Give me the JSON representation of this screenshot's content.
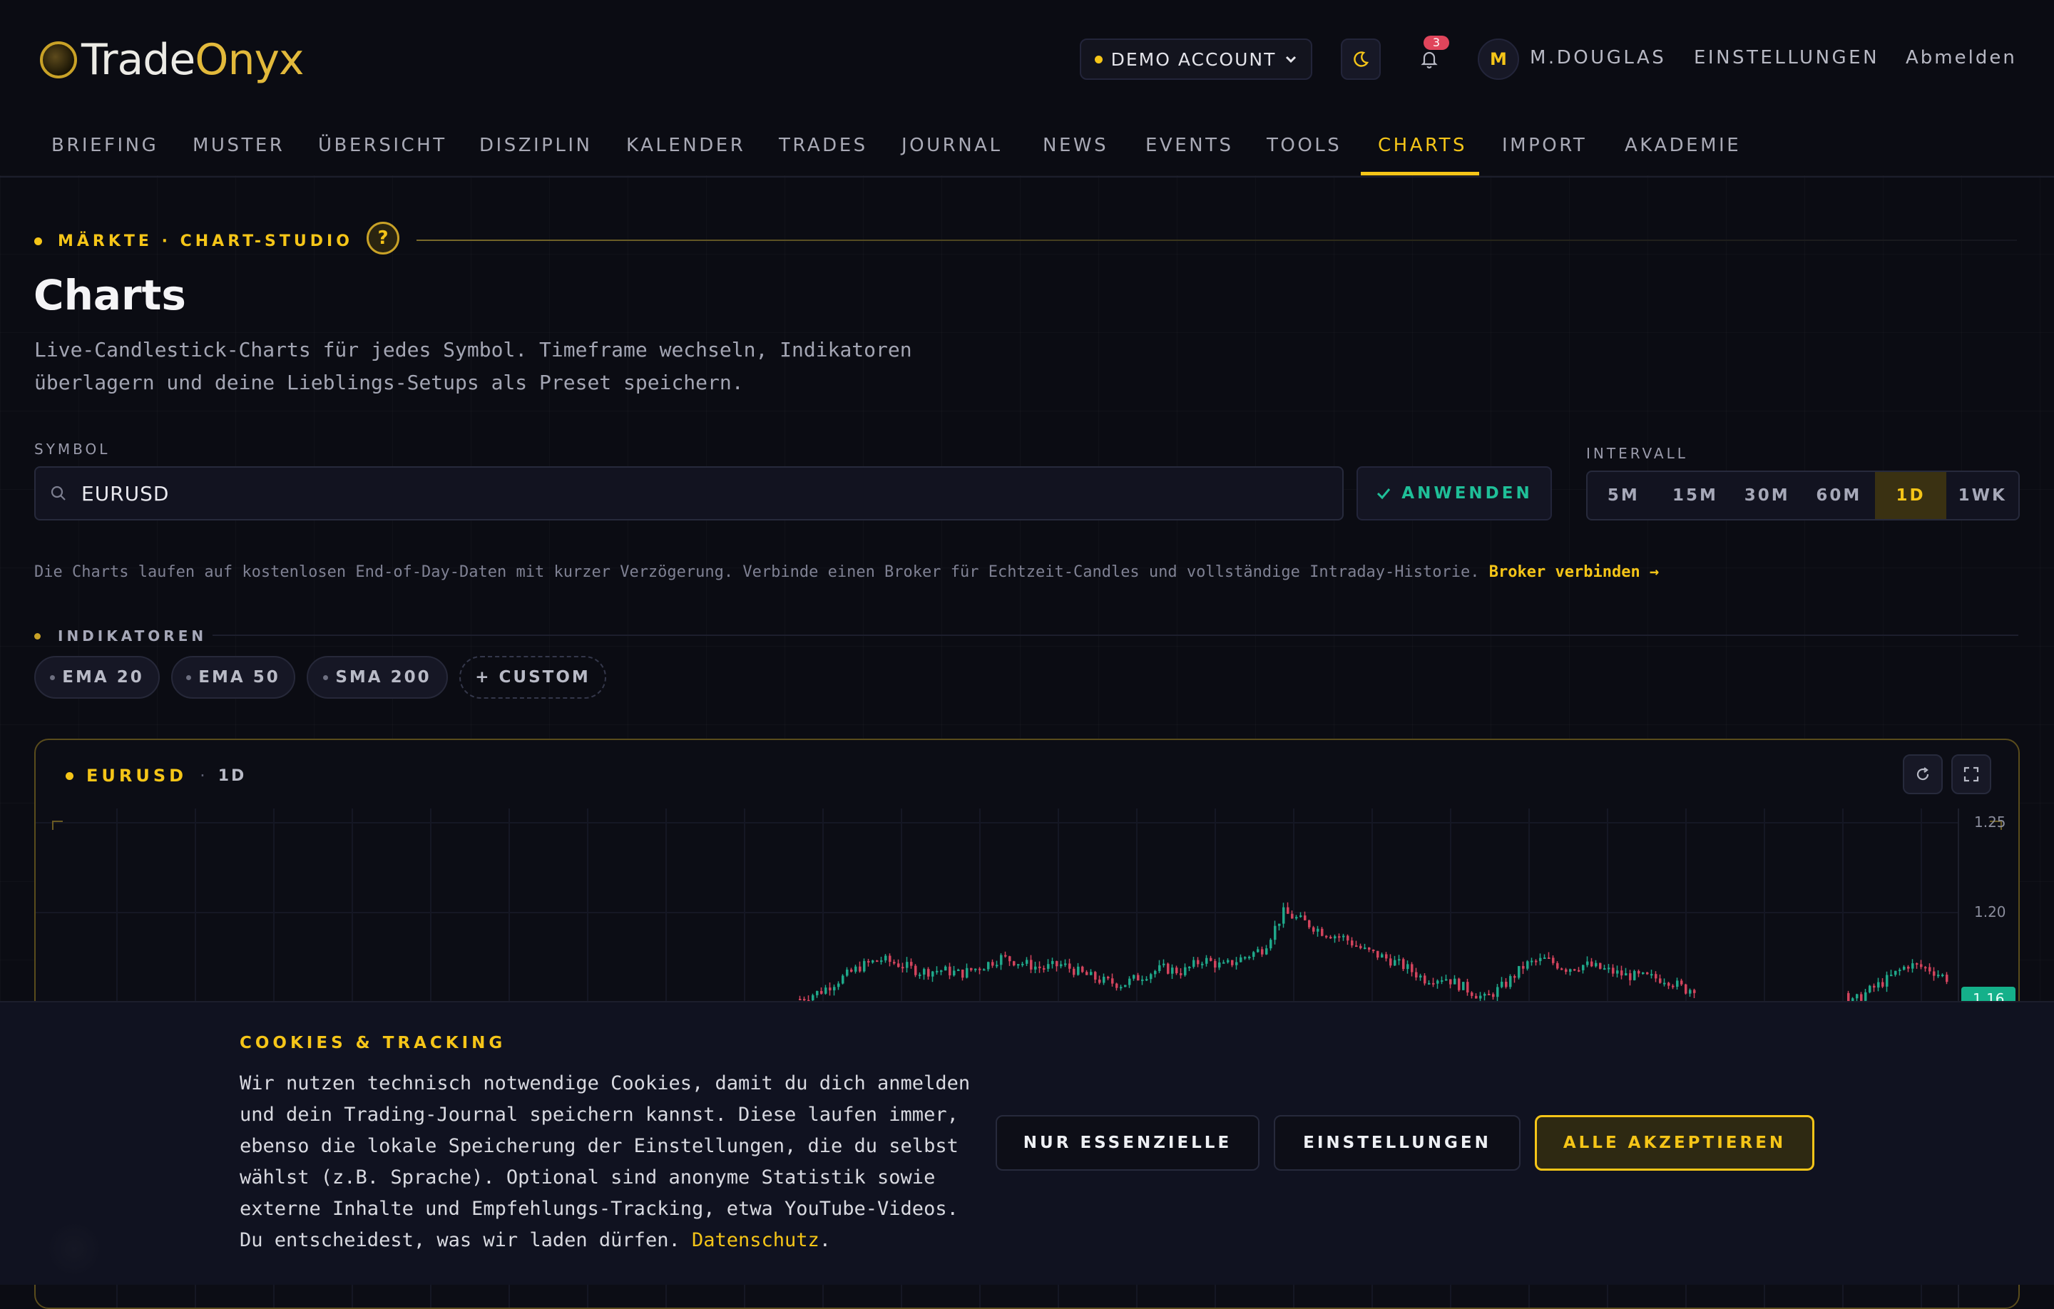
{
  "brand": {
    "name_part1": "Trade",
    "name_part2": "Onyx"
  },
  "header": {
    "account_label": "DEMO ACCOUNT",
    "notification_count": "3",
    "avatar_initial": "M",
    "username": "M.DOUGLAS",
    "settings_label": "EINSTELLUNGEN",
    "logout_label": "Abmelden"
  },
  "nav": {
    "items": [
      "BRIEFING",
      "MUSTER",
      "ÜBERSICHT",
      "DISZIPLIN",
      "KALENDER",
      "TRADES",
      "JOURNAL",
      "NEWS",
      "EVENTS",
      "TOOLS",
      "CHARTS",
      "IMPORT",
      "AKADEMIE"
    ],
    "active": "CHARTS"
  },
  "page": {
    "eyebrow": "MÄRKTE · CHART-STUDIO",
    "help_glyph": "?",
    "title": "Charts",
    "subtitle_line1": "Live-Candlestick-Charts für jedes Symbol. Timeframe wechseln, Indikatoren",
    "subtitle_line2": "überlagern und deine Lieblings-Setups als Preset speichern."
  },
  "symbol": {
    "label": "SYMBOL",
    "value": "EURUSD",
    "apply_label": "ANWENDEN"
  },
  "interval": {
    "label": "INTERVALL",
    "options": [
      "5M",
      "15M",
      "30M",
      "60M",
      "1D",
      "1WK"
    ],
    "selected": "1D"
  },
  "info": {
    "text": "Die Charts laufen auf kostenlosen End-of-Day-Daten mit kurzer Verzögerung. Verbinde einen Broker für Echtzeit-Candles und vollständige Intraday-Historie.",
    "link": "Broker verbinden →"
  },
  "indicators": {
    "label": "INDIKATOREN",
    "chips": [
      "EMA 20",
      "EMA 50",
      "SMA 200"
    ],
    "custom_label": "+ CUSTOM"
  },
  "chart": {
    "symbol": "EURUSD",
    "separator": "·",
    "timeframe": "1D",
    "price_labels": [
      "1.25",
      "1.20"
    ],
    "last_price_label": "1.16"
  },
  "chart_data": {
    "type": "candlestick",
    "symbol": "EURUSD",
    "interval": "1D",
    "y_ticks": [
      1.25,
      1.2
    ],
    "ylim": [
      1.15,
      1.25
    ],
    "colors": {
      "up": "#1fa88a",
      "down": "#d2445d"
    },
    "close_path": [
      1.152,
      1.156,
      1.163,
      1.17,
      1.174,
      1.171,
      1.167,
      1.168,
      1.166,
      1.17,
      1.175,
      1.172,
      1.169,
      1.171,
      1.166,
      1.162,
      1.16,
      1.165,
      1.169,
      1.167,
      1.174,
      1.17,
      1.175,
      1.18,
      1.2,
      1.195,
      1.189,
      1.186,
      1.179,
      1.175,
      1.17,
      1.163,
      1.164,
      1.158,
      1.152,
      1.16,
      1.171,
      1.174,
      1.169,
      1.171,
      1.168,
      1.165,
      1.164,
      1.163,
      1.157,
      1.16,
      1.166,
      1.17,
      1.168,
      1.165,
      1.158,
      1.15,
      1.148,
      1.156,
      1.163,
      1.171,
      1.169,
      1.163
    ]
  },
  "cookie": {
    "title": "COOKIES & TRACKING",
    "lines": [
      "Wir nutzen technisch notwendige Cookies, damit du dich anmelden",
      "und dein Trading-Journal speichern kannst. Diese laufen immer,",
      "ebenso die lokale Speicherung der Einstellungen, die du selbst",
      "wählst (z.B. Sprache). Optional sind anonyme Statistik sowie",
      "externe Inhalte und Empfehlungs-Tracking, etwa YouTube-Videos."
    ],
    "last_line": "Du entscheidest, was wir laden dürfen.",
    "link": "Datenschutz",
    "link_suffix": ".",
    "btn_essential": "NUR ESSENZIELLE",
    "btn_settings": "EINSTELLUNGEN",
    "btn_accept": "ALLE AKZEPTIEREN"
  }
}
